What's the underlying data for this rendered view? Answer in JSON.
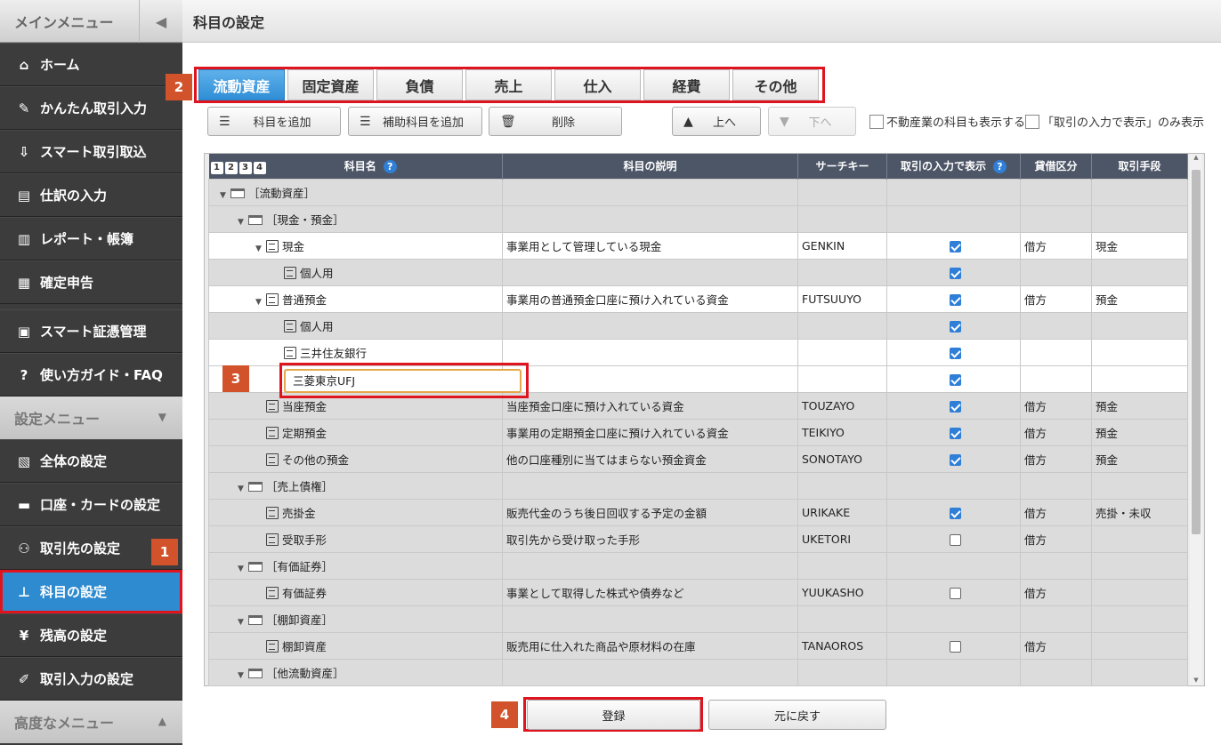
{
  "sidebar": {
    "main_menu": "メインメニュー",
    "items": [
      "ホーム",
      "かんたん取引入力",
      "スマート取引取込",
      "仕訳の入力",
      "レポート・帳簿",
      "確定申告"
    ],
    "items2": [
      "スマート証憑管理",
      "使い方ガイド・FAQ"
    ],
    "settings_menu": "設定メニュー",
    "settings": [
      "全体の設定",
      "口座・カードの設定",
      "取引先の設定",
      "科目の設定",
      "残高の設定",
      "取引入力の設定"
    ],
    "advanced_menu": "高度なメニュー"
  },
  "page": {
    "title": "科目の設定"
  },
  "tabs": [
    "流動資産",
    "固定資産",
    "負債",
    "売上",
    "仕入",
    "経費",
    "その他"
  ],
  "toolbar": {
    "add_account": "科目を追加",
    "add_sub": "補助科目を追加",
    "delete": "削除",
    "up": "上へ",
    "down": "下へ",
    "show_realestate": "不動産業の科目も表示する",
    "show_only": "「取引の入力で表示」のみ表示"
  },
  "table": {
    "levels": [
      "1",
      "2",
      "3",
      "4"
    ],
    "headers": [
      "科目名",
      "科目の説明",
      "サーチキー",
      "取引の入力で表示",
      "貸借区分",
      "取引手段"
    ],
    "rows": [
      {
        "name": "［流動資産］",
        "desc": "",
        "key": "",
        "show": null,
        "side": "",
        "method": ""
      },
      {
        "name": "［現金・預金］",
        "desc": "",
        "key": "",
        "show": null,
        "side": "",
        "method": ""
      },
      {
        "name": "現金",
        "desc": "事業用として管理している現金",
        "key": "GENKIN",
        "show": true,
        "side": "借方",
        "method": "現金"
      },
      {
        "name": "個人用",
        "desc": "",
        "key": "",
        "show": true,
        "side": "",
        "method": ""
      },
      {
        "name": "普通預金",
        "desc": "事業用の普通預金口座に預け入れている資金",
        "key": "FUTSUUYO",
        "show": true,
        "side": "借方",
        "method": "預金"
      },
      {
        "name": "個人用",
        "desc": "",
        "key": "",
        "show": true,
        "side": "",
        "method": ""
      },
      {
        "name": "三井住友銀行",
        "desc": "",
        "key": "",
        "show": true,
        "side": "",
        "method": ""
      },
      {
        "name": "",
        "desc": "",
        "key": "",
        "show": true,
        "side": "",
        "method": ""
      },
      {
        "name": "当座預金",
        "desc": "当座預金口座に預け入れている資金",
        "key": "TOUZAYO",
        "show": true,
        "side": "借方",
        "method": "預金"
      },
      {
        "name": "定期預金",
        "desc": "事業用の定期預金口座に預け入れている資金",
        "key": "TEIKIYO",
        "show": true,
        "side": "借方",
        "method": "預金"
      },
      {
        "name": "その他の預金",
        "desc": "他の口座種別に当てはまらない預金資金",
        "key": "SONOTAYO",
        "show": true,
        "side": "借方",
        "method": "預金"
      },
      {
        "name": "［売上債権］",
        "desc": "",
        "key": "",
        "show": null,
        "side": "",
        "method": ""
      },
      {
        "name": "売掛金",
        "desc": "販売代金のうち後日回収する予定の金額",
        "key": "URIKAKE",
        "show": true,
        "side": "借方",
        "method": "売掛・未収"
      },
      {
        "name": "受取手形",
        "desc": "取引先から受け取った手形",
        "key": "UKETORI",
        "show": false,
        "side": "借方",
        "method": ""
      },
      {
        "name": "［有価証券］",
        "desc": "",
        "key": "",
        "show": null,
        "side": "",
        "method": ""
      },
      {
        "name": "有価証券",
        "desc": "事業として取得した株式や債券など",
        "key": "YUUKASHO",
        "show": false,
        "side": "借方",
        "method": ""
      },
      {
        "name": "［棚卸資産］",
        "desc": "",
        "key": "",
        "show": null,
        "side": "",
        "method": ""
      },
      {
        "name": "棚卸資産",
        "desc": "販売用に仕入れた商品や原材料の在庫",
        "key": "TANAOROS",
        "show": false,
        "side": "借方",
        "method": ""
      },
      {
        "name": "［他流動資産］",
        "desc": "",
        "key": "",
        "show": null,
        "side": "",
        "method": ""
      }
    ],
    "edit_value": "三菱東京UFJ"
  },
  "footer": {
    "register": "登録",
    "revert": "元に戻す"
  },
  "badges": [
    "1",
    "2",
    "3",
    "4"
  ]
}
